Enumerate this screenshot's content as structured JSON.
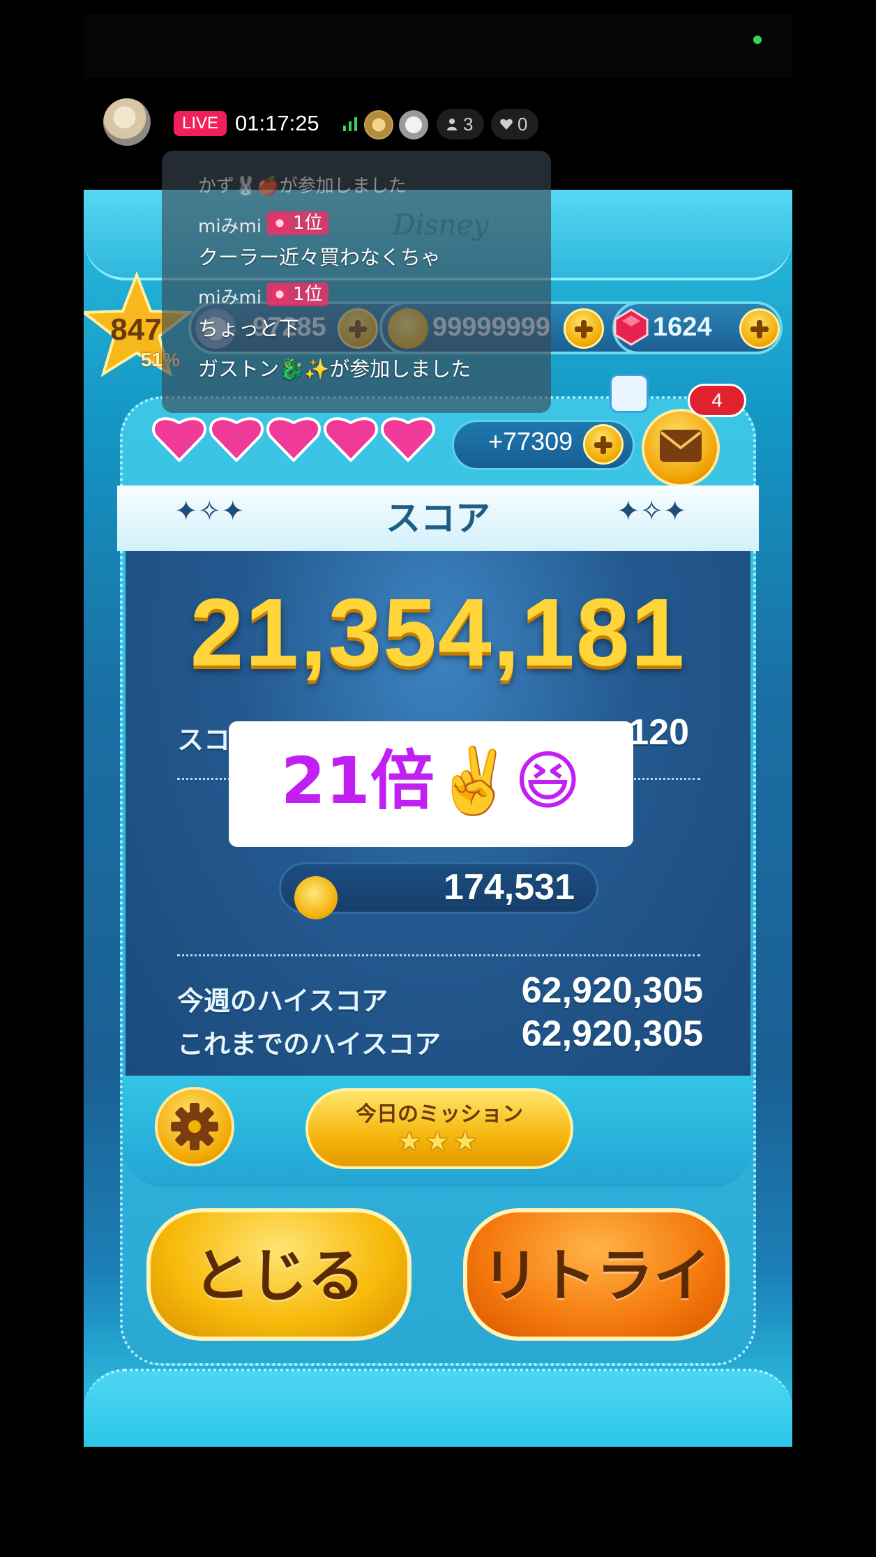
{
  "live": {
    "badge": "LIVE",
    "elapsed": "01:17:25",
    "viewers": "3",
    "likes": "0"
  },
  "chat": {
    "faded_join": "かず🐰🍎が参加しました",
    "messages": [
      {
        "user": "miみmi",
        "rank": "1位",
        "text": "クーラー近々買わなくちゃ"
      },
      {
        "user": "miみmi",
        "rank": "1位",
        "text": "ちょっと下"
      }
    ],
    "join_notice": "ガストン🐉✨が参加しました"
  },
  "game": {
    "level": "847",
    "level_progress": "51%",
    "currency": {
      "tickets": "97285",
      "coins": "99999999",
      "rubies": "1624"
    },
    "hearts_count": 5,
    "heart_bonus": "+77309",
    "mail_count": "4",
    "score_title": "スコア",
    "score": "21,354,181",
    "score_row_label": "スコ",
    "score_row_value_partial": "120",
    "coins_earned": "174,531",
    "weekly_high_label": "今週のハイスコア",
    "weekly_high_value": "62,920,305",
    "alltime_high_label": "これまでのハイスコア",
    "alltime_high_value": "62,920,305",
    "mission_label": "今日のミッション",
    "mission_stars": "★★★",
    "close_label": "とじる",
    "retry_label": "リトライ"
  },
  "caption": {
    "text": "21倍✌️😆"
  }
}
